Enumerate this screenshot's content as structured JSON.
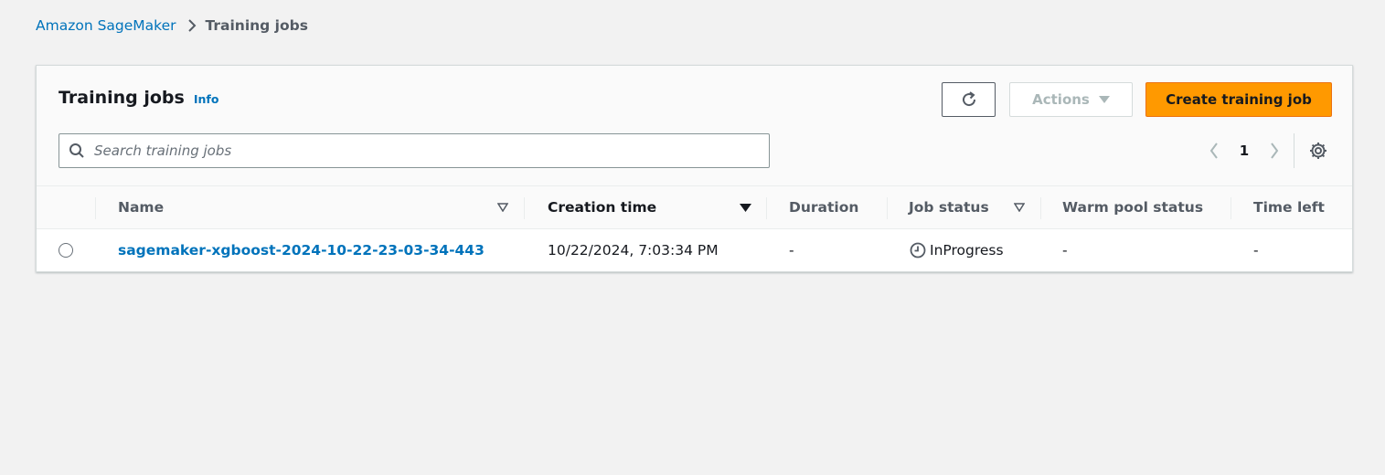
{
  "breadcrumb": {
    "root": "Amazon SageMaker",
    "current": "Training jobs"
  },
  "panel": {
    "title": "Training jobs",
    "info": "Info"
  },
  "toolbar": {
    "refresh_icon": "refresh-icon",
    "actions_label": "Actions",
    "create_label": "Create training job"
  },
  "search": {
    "placeholder": "Search training jobs",
    "value": ""
  },
  "pagination": {
    "page": "1"
  },
  "table": {
    "columns": [
      "Name",
      "Creation time",
      "Duration",
      "Job status",
      "Warm pool status",
      "Time left"
    ],
    "rows": [
      {
        "name": "sagemaker-xgboost-2024-10-22-23-03-34-443",
        "creation_time": "10/22/2024, 7:03:34 PM",
        "duration": "-",
        "status": "InProgress",
        "warm_pool_status": "-",
        "time_left": "-"
      }
    ]
  },
  "colors": {
    "accent": "#0073bb",
    "primary_button": "#ff9900",
    "background": "#f2f2f2"
  }
}
